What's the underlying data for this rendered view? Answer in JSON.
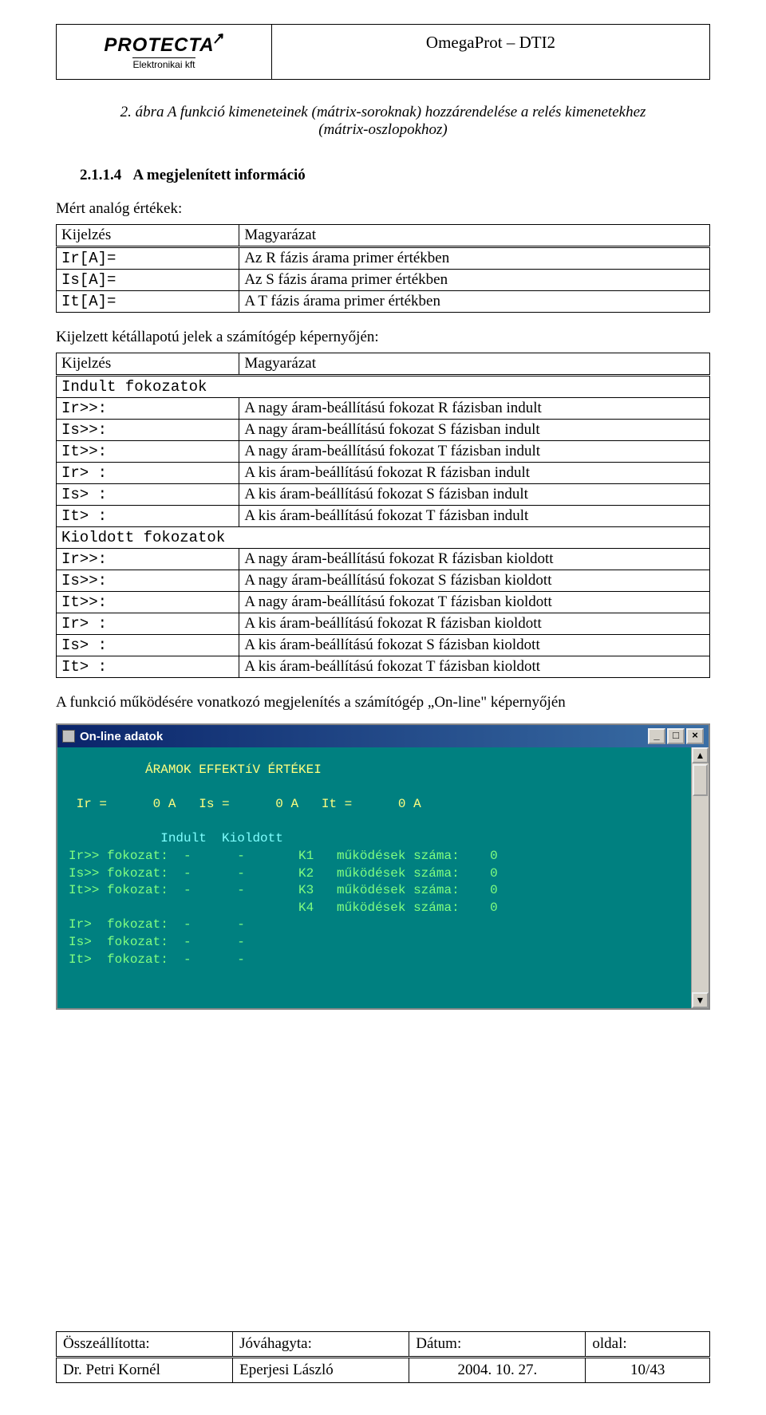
{
  "header": {
    "logo_main": "PROTECTA",
    "logo_sub": "Elektronikai kft",
    "doc_title": "OmegaProt – DTI2"
  },
  "caption": "2. ábra A funkció kimeneteinek (mátrix-soroknak) hozzárendelése a relés kimenetekhez (mátrix-oszlopokhoz)",
  "section": {
    "number": "2.1.1.4",
    "title": "A megjelenített információ"
  },
  "analog": {
    "intro": "Mért analóg értékek:",
    "head_col1": "Kijelzés",
    "head_col2": "Magyarázat",
    "rows": [
      {
        "code": "Ir[A]=",
        "desc": "Az R fázis árama primer értékben"
      },
      {
        "code": "Is[A]=",
        "desc": "Az S fázis árama primer értékben"
      },
      {
        "code": "It[A]=",
        "desc": "A  T fázis árama primer értékben"
      }
    ]
  },
  "binary": {
    "intro": "Kijelzett kétállapotú jelek a számítógép képernyőjén:",
    "head_col1": "Kijelzés",
    "head_col2": "Magyarázat",
    "sub1": "Indult fokozatok",
    "rows1": [
      {
        "code": "Ir>>:",
        "desc": "A nagy áram-beállítású fokozat R fázisban indult"
      },
      {
        "code": "Is>>:",
        "desc": "A nagy áram-beállítású fokozat S fázisban indult"
      },
      {
        "code": "It>>:",
        "desc": "A nagy áram-beállítású fokozat T fázisban indult"
      },
      {
        "code": "Ir> :",
        "desc": "A kis áram-beállítású fokozat R fázisban indult"
      },
      {
        "code": "Is> :",
        "desc": "A kis áram-beállítású fokozat S fázisban indult"
      },
      {
        "code": "It> :",
        "desc": "A kis áram-beállítású fokozat T fázisban indult"
      }
    ],
    "sub2": "Kioldott fokozatok",
    "rows2": [
      {
        "code": "Ir>>:",
        "desc": "A nagy áram-beállítású fokozat R fázisban kioldott"
      },
      {
        "code": "Is>>:",
        "desc": "A nagy áram-beállítású fokozat S fázisban kioldott"
      },
      {
        "code": "It>>:",
        "desc": "A nagy áram-beállítású fokozat T fázisban kioldott"
      },
      {
        "code": "Ir> :",
        "desc": "A kis áram-beállítású fokozat R fázisban kioldott"
      },
      {
        "code": "Is> :",
        "desc": "A kis áram-beállítású fokozat S fázisban kioldott"
      },
      {
        "code": "It> :",
        "desc": "A kis áram-beállítású fokozat T fázisban kioldott"
      }
    ]
  },
  "note": "A funkció működésére vonatkozó megjelenítés a számítógép „On-line\" képernyőjén",
  "terminal": {
    "title": "On-line adatok",
    "line_header": "          ÁRAMOK EFFEKTíV ÉRTÉKEI",
    "line_currents": " Ir =      0 A   Is =      0 A   It =      0 A",
    "line_cols": "            Indult  Kioldott",
    "rows": [
      "Ir>> fokozat:  -      -       K1   működések száma:    0",
      "Is>> fokozat:  -      -       K2   működések száma:    0",
      "It>> fokozat:  -      -       K3   működések száma:    0",
      "                              K4   működések száma:    0",
      "Ir>  fokozat:  -      -",
      "Is>  fokozat:  -      -",
      "It>  fokozat:  -      -"
    ]
  },
  "footer": {
    "h1": "Összeállította:",
    "h2": "Jóváhagyta:",
    "h3": "Dátum:",
    "h4": "oldal:",
    "v1": "Dr. Petri Kornél",
    "v2": "Eperjesi László",
    "v3": "2004. 10. 27.",
    "v4": "10/43"
  }
}
